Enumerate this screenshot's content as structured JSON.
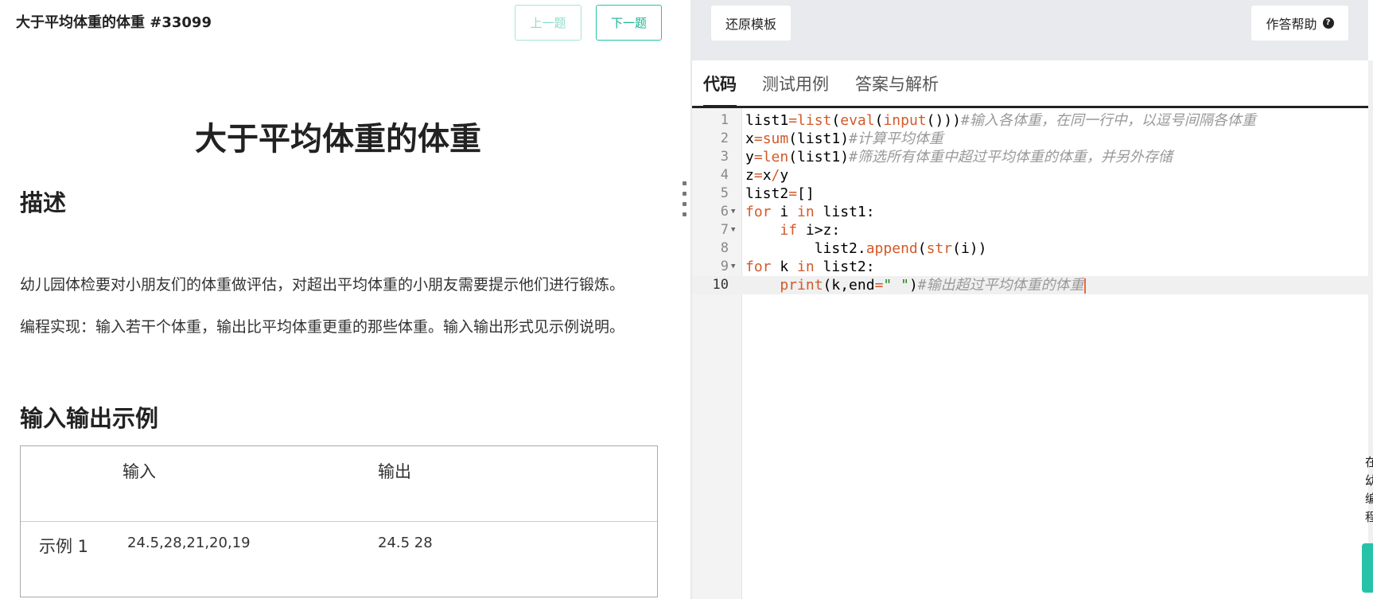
{
  "problem": {
    "header_title": "大于平均体重的体重 #33099",
    "prev_label": "上一题",
    "next_label": "下一题",
    "title": "大于平均体重的体重",
    "desc_heading": "描述",
    "desc_p1": "幼儿园体检要对小朋友们的体重做评估，对超出平均体重的小朋友需要提示他们进行锻炼。",
    "desc_p2": "编程实现：输入若干个体重，输出比平均体重更重的那些体重。输入输出形式见示例说明。",
    "io_heading": "输入输出示例",
    "io_table": {
      "col_input": "输入",
      "col_output": "输出",
      "rows": [
        {
          "label": "示例 1",
          "input": "24.5,28,21,20,19",
          "output": "24.5 28"
        }
      ]
    }
  },
  "toolbar": {
    "reset_label": "还原模板",
    "help_label": "作答帮助",
    "help_icon": "question-circle-icon"
  },
  "tabs": [
    {
      "label": "代码",
      "active": true
    },
    {
      "label": "测试用例",
      "active": false
    },
    {
      "label": "答案与解析",
      "active": false
    }
  ],
  "editor": {
    "active_line": 10,
    "lines": [
      {
        "n": "1",
        "text": "list1=list(eval(input()))#输入各体重，在同一行中，以逗号间隔各体重"
      },
      {
        "n": "2",
        "text": "x=sum(list1)#计算平均体重"
      },
      {
        "n": "3",
        "text": "y=len(list1)#筛选所有体重中超过平均体重的体重，并另外存储"
      },
      {
        "n": "4",
        "text": "z=x/y"
      },
      {
        "n": "5",
        "text": "list2=[]"
      },
      {
        "n": "6",
        "text": "for i in list1:"
      },
      {
        "n": "7",
        "text": "    if i>z:"
      },
      {
        "n": "8",
        "text": "        list2.append(str(i))"
      },
      {
        "n": "9",
        "text": "for k in list2:"
      },
      {
        "n": "10",
        "text": "    print(k,end=\" \")#输出超过平均体重的体重"
      }
    ]
  },
  "colors": {
    "accent": "#26c3a8",
    "keyword": "#d35a2a",
    "comment": "#999999",
    "string": "#1a8a1a"
  }
}
